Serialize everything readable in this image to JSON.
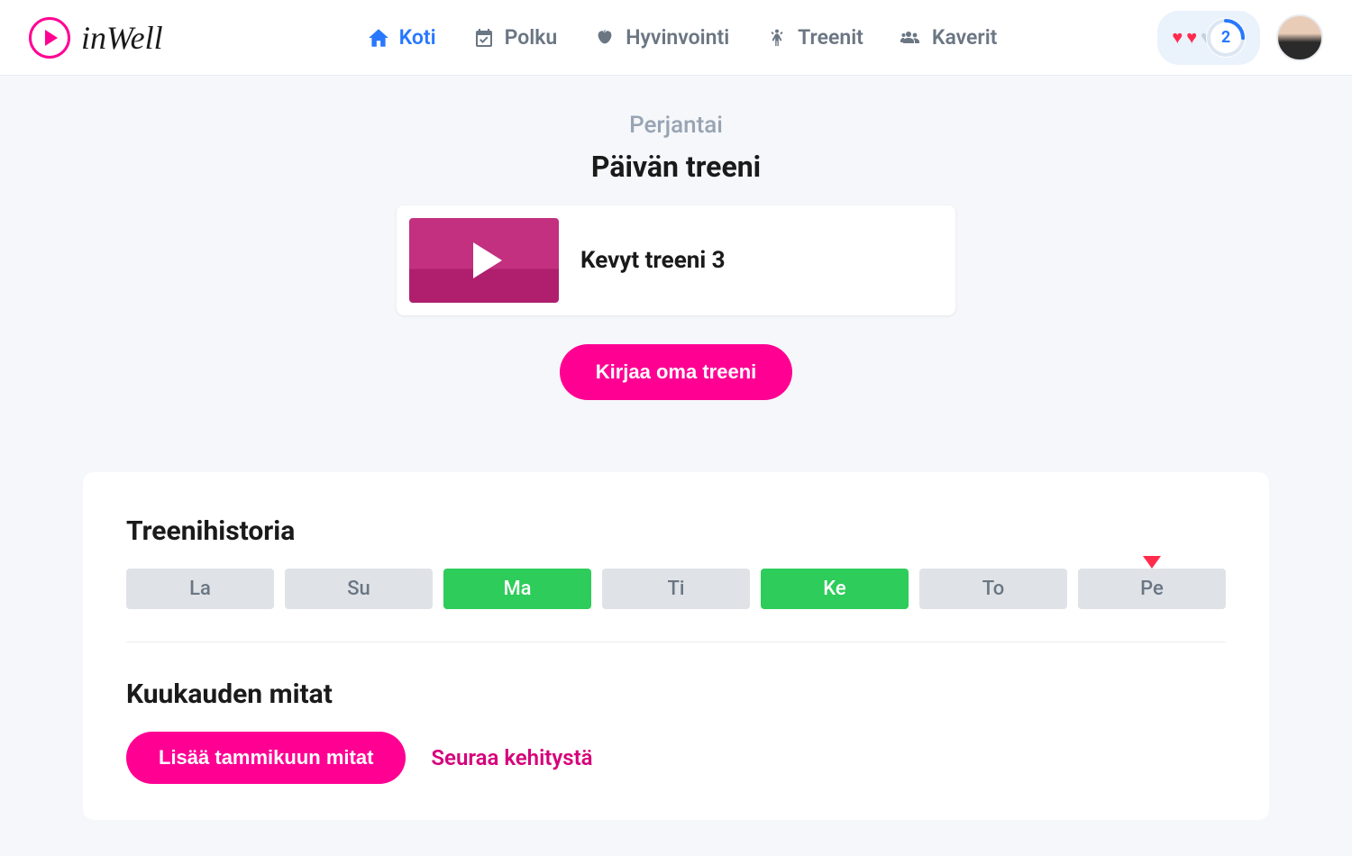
{
  "brand": {
    "name": "inWell"
  },
  "nav": {
    "home": "Koti",
    "path": "Polku",
    "wellbeing": "Hyvinvointi",
    "workouts": "Treenit",
    "friends": "Kaverit"
  },
  "header": {
    "progress_count": "2"
  },
  "today": {
    "day_label": "Perjantai",
    "section_title": "Päivän treeni",
    "workout_title": "Kevyt treeni 3",
    "cta_label": "Kirjaa oma treeni"
  },
  "history": {
    "title": "Treenihistoria",
    "days": [
      {
        "label": "La",
        "active": false,
        "marker": false
      },
      {
        "label": "Su",
        "active": false,
        "marker": false
      },
      {
        "label": "Ma",
        "active": true,
        "marker": false
      },
      {
        "label": "Ti",
        "active": false,
        "marker": false
      },
      {
        "label": "Ke",
        "active": true,
        "marker": false
      },
      {
        "label": "To",
        "active": false,
        "marker": false
      },
      {
        "label": "Pe",
        "active": false,
        "marker": true
      }
    ]
  },
  "measures": {
    "title": "Kuukauden mitat",
    "add_button": "Lisää tammikuun mitat",
    "follow_link": "Seuraa kehitystä"
  }
}
